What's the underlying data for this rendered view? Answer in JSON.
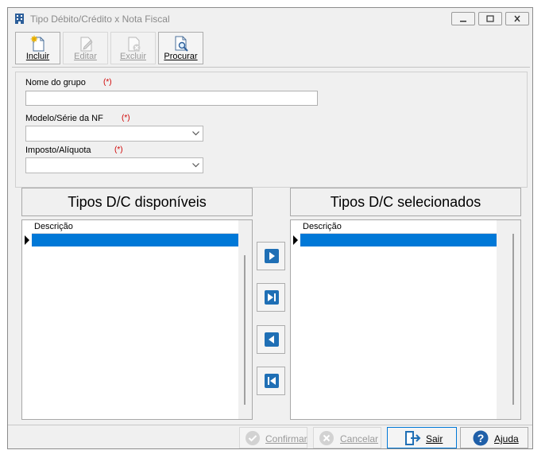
{
  "window": {
    "title": "Tipo Débito/Crédito  x Nota Fiscal",
    "icon": "building-icon",
    "controls": [
      "minimize-icon",
      "maximize-icon",
      "close-icon"
    ]
  },
  "toolbar": {
    "incluir": {
      "label": "Incluir",
      "icon": "new-document-icon",
      "enabled": true
    },
    "editar": {
      "label": "Editar",
      "icon": "edit-document-icon",
      "enabled": false
    },
    "excluir": {
      "label": "Excluir",
      "icon": "delete-document-icon",
      "enabled": false
    },
    "procurar": {
      "label": "Procurar",
      "icon": "search-document-icon",
      "enabled": true
    }
  },
  "form": {
    "nome_grupo": {
      "label": "Nome do grupo",
      "required_mark": "(*)",
      "value": "",
      "placeholder": ""
    },
    "modelo_serie": {
      "label": "Modelo/Série da NF",
      "required_mark": "(*)",
      "value": ""
    },
    "imposto_aliquota": {
      "label": "Imposto/Alíquota",
      "required_mark": "(*)",
      "value": ""
    }
  },
  "panels": {
    "disponiveis": {
      "title": "Tipos D/C disponíveis",
      "column": "Descrição"
    },
    "selecionados": {
      "title": "Tipos D/C selecionados",
      "column": "Descrição"
    }
  },
  "move_buttons": [
    "move-right-icon",
    "move-all-right-icon",
    "move-left-icon",
    "move-all-left-icon"
  ],
  "footer": {
    "confirmar": {
      "label": "Confirmar",
      "icon": "check-icon",
      "enabled": false
    },
    "cancelar": {
      "label": "Cancelar",
      "icon": "cancel-icon",
      "enabled": false
    },
    "sair": {
      "label": "Sair",
      "icon": "exit-icon",
      "enabled": true
    },
    "ajuda": {
      "label": "Ajuda",
      "icon": "help-icon",
      "enabled": true
    }
  },
  "colors": {
    "selection": "#0078d7",
    "required": "#d00000",
    "accent_blue": "#1f6fb5"
  }
}
